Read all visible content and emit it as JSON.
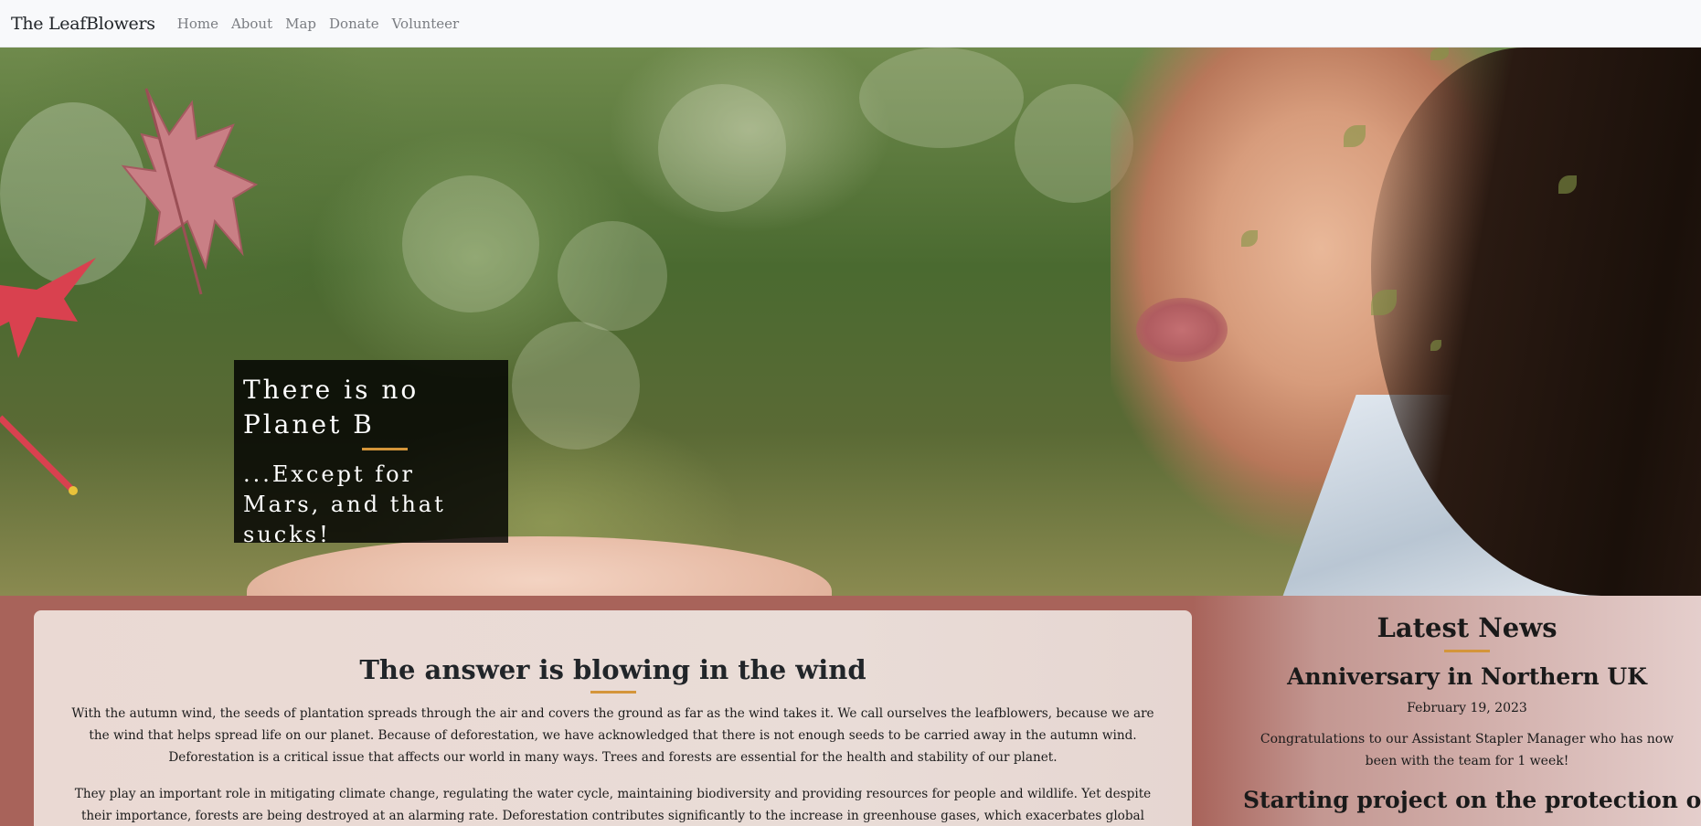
{
  "navbar": {
    "brand": "The LeafBlowers",
    "links": [
      "Home",
      "About",
      "Map",
      "Donate",
      "Volunteer"
    ]
  },
  "hero": {
    "title": "There is no Planet B",
    "subtitle": "...Except for Mars, and that sucks!"
  },
  "article": {
    "title": "The answer is blowing in the wind",
    "paragraphs": [
      "With the autumn wind, the seeds of plantation spreads through the air and covers the ground as far as the wind takes it. We call ourselves the leafblowers, because we are the wind that helps spread life on our planet. Because of deforestation, we have acknowledged that there is not enough seeds to be carried away in the autumn wind. Deforestation is a critical issue that affects our world in many ways. Trees and forests are essential for the health and stability of our planet.",
      "They play an important role in mitigating climate change, regulating the water cycle, maintaining biodiversity and providing resources for people and wildlife. Yet despite their importance, forests are being destroyed at an alarming rate. Deforestation contributes significantly to the increase in greenhouse gases, which exacerbates global"
    ]
  },
  "news": {
    "heading": "Latest News",
    "items": [
      {
        "title": "Anniversary in Northern UK",
        "date": "February 19, 2023",
        "text": "Congratulations to our Assistant Stapler Manager who has now been with the team for 1 week!"
      },
      {
        "title": "Starting project on the protection of"
      }
    ]
  },
  "colors": {
    "accent": "#d4953a",
    "page_bg": "#a8635a",
    "navbar_bg": "#f8f9fb"
  }
}
